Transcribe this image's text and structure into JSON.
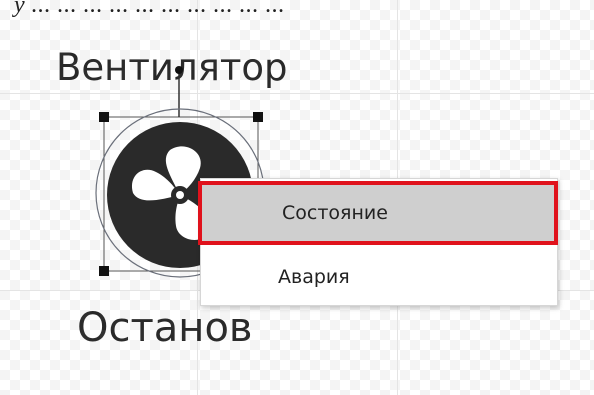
{
  "header": {
    "cut_text": "у ... ... ... ... ... ... ... ... ... ..."
  },
  "widget": {
    "title": "Вентилятор",
    "status_label": "Останов",
    "icon": "fan-icon"
  },
  "context_menu": {
    "items": [
      {
        "label": "Состояние",
        "highlighted": true
      },
      {
        "label": "Авария",
        "highlighted": false
      }
    ]
  },
  "colors": {
    "highlight_border": "#e0121c",
    "highlight_fill": "#cfcfcf",
    "fan_fill": "#2a2a2a"
  }
}
